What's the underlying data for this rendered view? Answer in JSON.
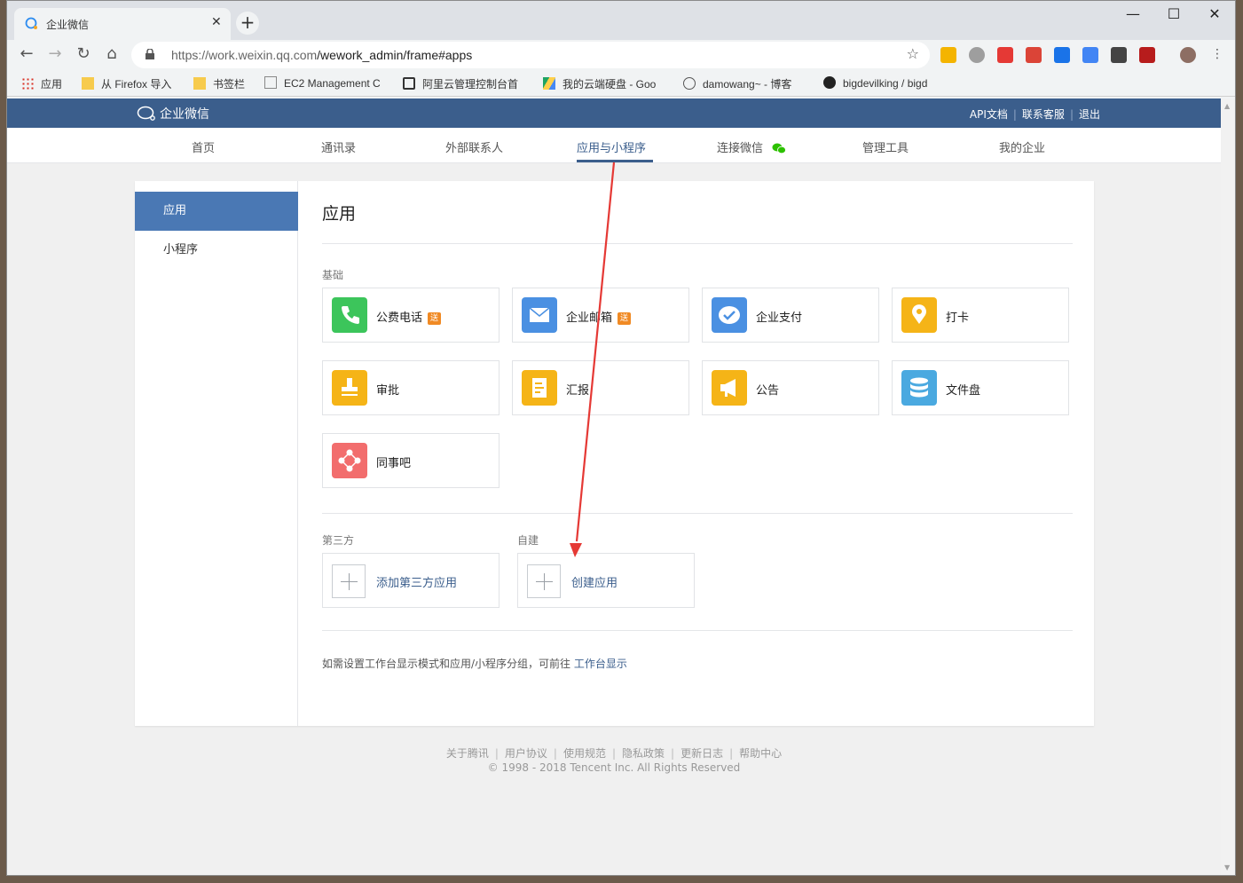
{
  "browser": {
    "tab_title": "企业微信",
    "tab_close": "✕",
    "new_tab": "+",
    "url_host": "https://work.weixin.qq.com",
    "url_path": "/wework_admin/frame#apps",
    "window_controls": [
      "—",
      "☐",
      "✕"
    ]
  },
  "bookmarks": [
    {
      "label": "应用",
      "icon": "apps-grid-icon",
      "color": "#d93025"
    },
    {
      "label": "从 Firefox 导入",
      "icon": "folder-icon",
      "color": "#f7cb4d"
    },
    {
      "label": "书签栏",
      "icon": "folder-icon",
      "color": "#f7cb4d"
    },
    {
      "label": "EC2 Management C",
      "icon": "page-icon",
      "color": "#888888"
    },
    {
      "label": "阿里云管理控制台首",
      "icon": "aliyun-icon",
      "color": "#333333"
    },
    {
      "label": "我的云端硬盘 - Goo",
      "icon": "drive-icon",
      "color": "#1fa463"
    },
    {
      "label": "damowang~ - 博客",
      "icon": "blog-icon",
      "color": "#555555"
    },
    {
      "label": "bigdevilking / bigd",
      "icon": "github-icon",
      "color": "#222222"
    }
  ],
  "header": {
    "logo_text": "企业微信",
    "links": [
      "API文档",
      "联系客服",
      "退出"
    ]
  },
  "nav": {
    "items": [
      "首页",
      "通讯录",
      "外部联系人",
      "应用与小程序",
      "连接微信",
      "管理工具",
      "我的企业"
    ],
    "active_index": 3
  },
  "sidebar": {
    "items": [
      "应用",
      "小程序"
    ]
  },
  "main": {
    "title": "应用",
    "section_basic": "基础",
    "basic_apps": [
      {
        "label": "公费电话",
        "badge": "送",
        "icon": "phone-icon",
        "color": "#3cc55b"
      },
      {
        "label": "企业邮箱",
        "badge": "送",
        "icon": "mail-icon",
        "color": "#4a90e2"
      },
      {
        "label": "企业支付",
        "badge": "",
        "icon": "pay-icon",
        "color": "#4a90e2"
      },
      {
        "label": "打卡",
        "badge": "",
        "icon": "location-pin-icon",
        "color": "#f5b417"
      },
      {
        "label": "审批",
        "badge": "",
        "icon": "stamp-icon",
        "color": "#f5b417"
      },
      {
        "label": "汇报",
        "badge": "",
        "icon": "report-icon",
        "color": "#f5b417"
      },
      {
        "label": "公告",
        "badge": "",
        "icon": "megaphone-icon",
        "color": "#f5b417"
      },
      {
        "label": "文件盘",
        "badge": "",
        "icon": "database-icon",
        "color": "#4aa9e0"
      },
      {
        "label": "同事吧",
        "badge": "",
        "icon": "network-icon",
        "color": "#f26d6d"
      }
    ],
    "section_third": "第三方",
    "section_custom": "自建",
    "add_third_party": "添加第三方应用",
    "create_app": "创建应用",
    "hint_text": "如需设置工作台显示模式和应用/小程序分组，可前往",
    "hint_link": "工作台显示"
  },
  "footer": {
    "links": [
      "关于腾讯",
      "用户协议",
      "使用规范",
      "隐私政策",
      "更新日志",
      "帮助中心"
    ],
    "copyright": "© 1998 - 2018 Tencent Inc. All Rights Reserved"
  }
}
